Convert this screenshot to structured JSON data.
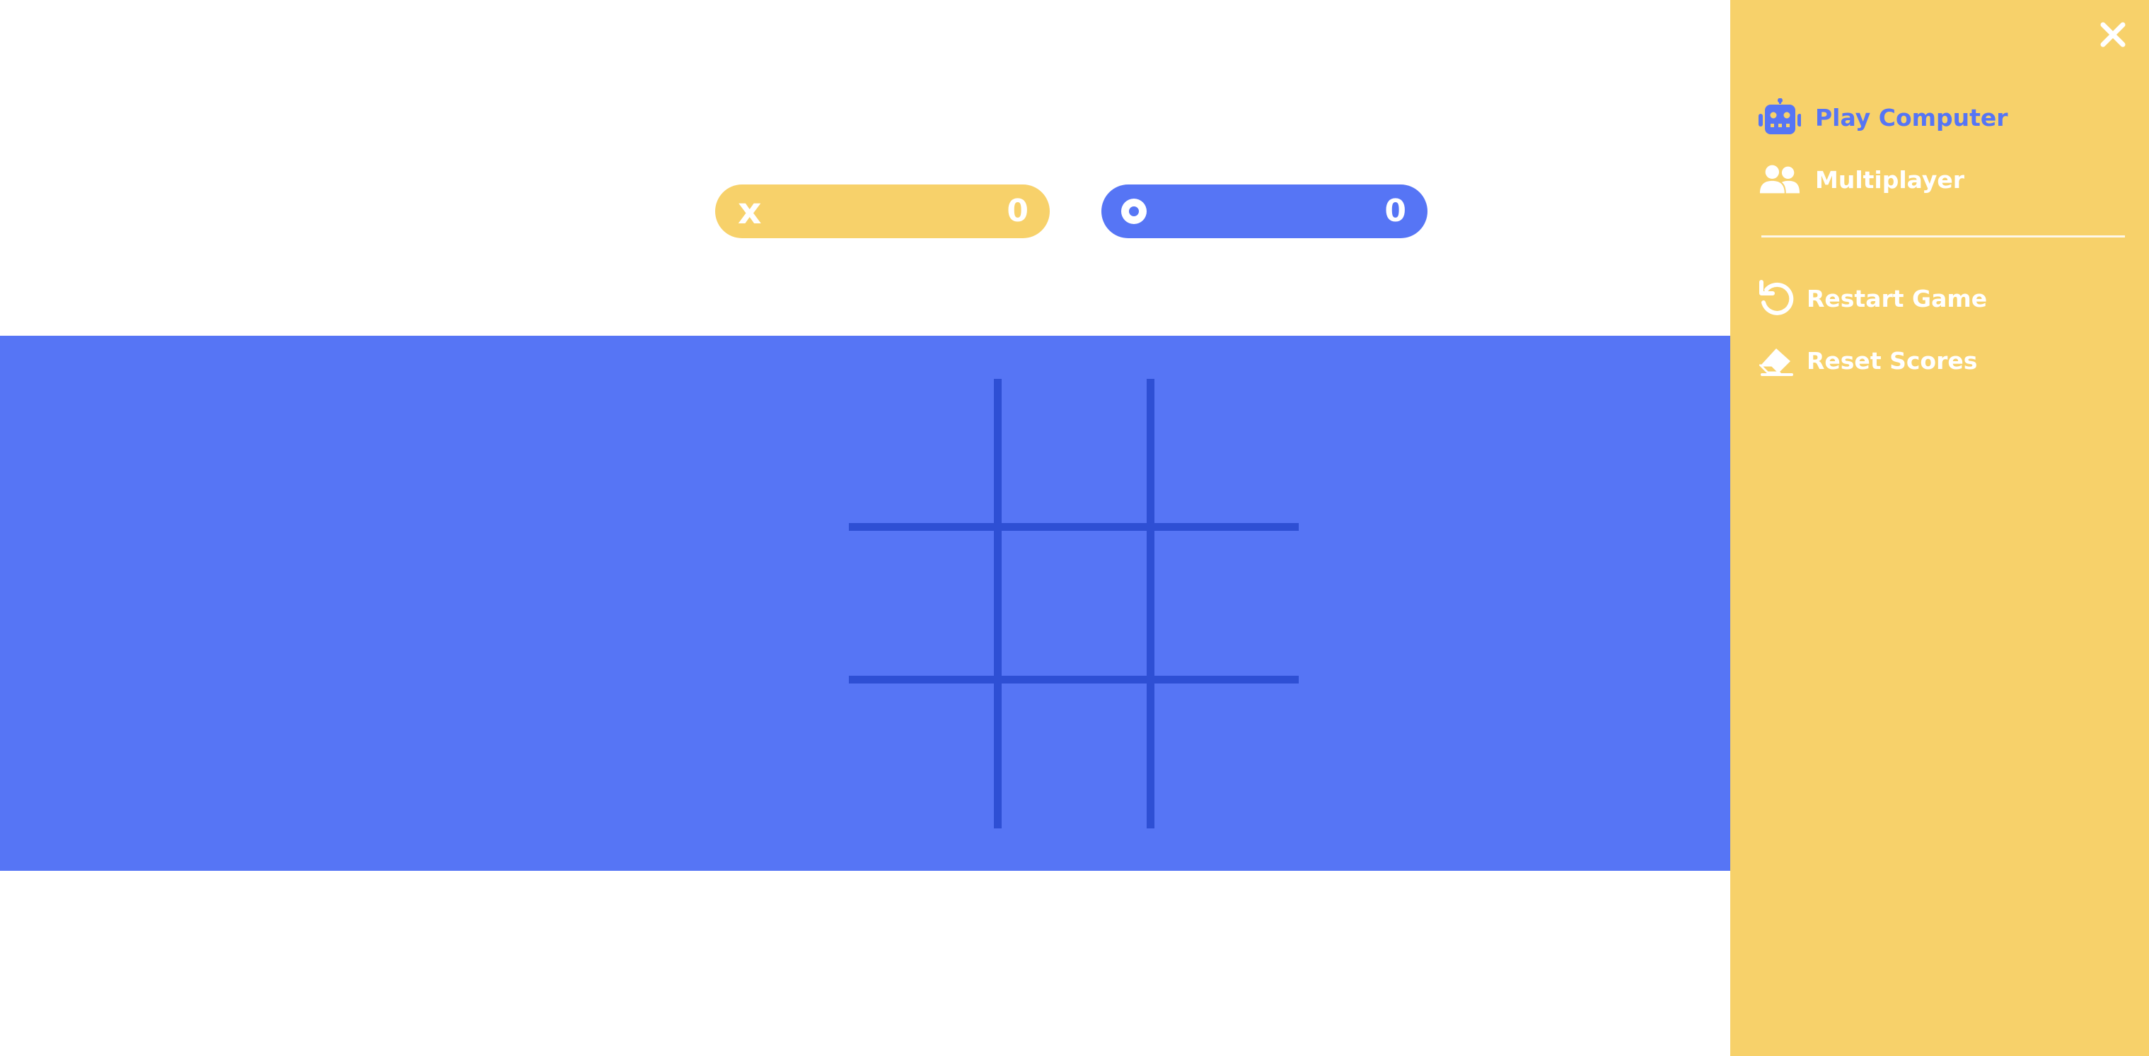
{
  "scoreboard": {
    "x": {
      "mark": "x",
      "score": "0",
      "color": "#f7d16a"
    },
    "o": {
      "mark": "o",
      "score": "0",
      "color": "#5675f5"
    }
  },
  "board": {
    "background": "#5675f5",
    "line_color": "#2e4fd4",
    "cells": [
      "",
      "",
      "",
      "",
      "",
      "",
      "",
      "",
      ""
    ]
  },
  "menu": {
    "close_icon": "close-icon",
    "items": [
      {
        "label": "Play Computer",
        "icon": "robot-icon",
        "active": true
      },
      {
        "label": "Multiplayer",
        "icon": "users-icon",
        "active": false
      },
      {
        "label": "Restart Game",
        "icon": "undo-icon",
        "active": false
      },
      {
        "label": "Reset Scores",
        "icon": "eraser-icon",
        "active": false
      }
    ],
    "background": "#f7d16a",
    "active_color": "#5675f5"
  }
}
